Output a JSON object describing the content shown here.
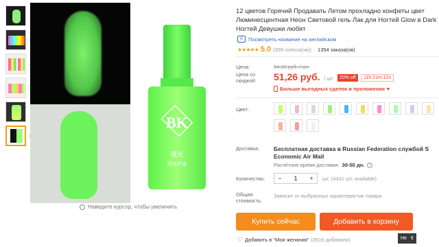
{
  "product": {
    "title_line1": "12 цветов Горячий Продавать Летом прохладно конфеты цвет",
    "title_line2": "Люминесцентная Неон Световой гель Лак для Ногтей Glow в Dark",
    "title_line3": "Ногтей Девушки любят",
    "translate_link": "Посмотреть название на английском",
    "translate_icon": "A",
    "rating": "5.0",
    "stars": "★★★★★",
    "votes": "(359 голоса(ов))",
    "orders": "1354 заказа(ов)"
  },
  "gallery": {
    "zoom_hint": "Наведите курсор, чтобы увеличить",
    "bottle_logo": "BK",
    "bottle_text1": "夜光",
    "bottle_text2": "荧光甲油"
  },
  "pricing": {
    "label_price": "Цена:",
    "old_price": "64,39 руб. / шт.",
    "label_discount_price_1": "Цена со",
    "label_discount_price_2": "скидкой:",
    "price": "51,26 руб.",
    "per_unit": "/ шт.",
    "discount": "20% off",
    "timer": "11h:21m:12s",
    "app_deals": "Больше выгодных сделок в приложении",
    "app_deals_chevron": "▾"
  },
  "options": {
    "label_color": "Цвет:",
    "swatches": [
      "#caff5b",
      "#f5b8c8",
      "#d9d9d9",
      "#9ef07a",
      "#46b8ff",
      "#ffd75b",
      "#ff8ad8",
      "#aaffaa",
      "#d9c7ff",
      "#ffe0b0",
      "#ffb0a0",
      "#ff9a9a",
      "#f6f0e8"
    ]
  },
  "shipping": {
    "label": "Доставка:",
    "main_line1": "Бесплатная доставка в Russian Federation службой S",
    "main_line2": "Economic Air Mail",
    "time_label": "Расчётное время доставки:",
    "time_days": "30-50 дн.",
    "info": "i"
  },
  "quantity": {
    "label": "Количество:",
    "minus": "−",
    "value": "1",
    "plus": "+",
    "available": "шт. (4431 шт. available)",
    "total_label_1": "Общая",
    "total_label_2": "стоимость:",
    "total_hint": "Зависит от выбранных характеристик товара"
  },
  "actions": {
    "buy_now": "Купить сейчас",
    "add_to_cart": "Добавить в корзину",
    "wishlist": "Добавить в \"Мои желания\"",
    "wishlist_count": "(3516 добавили)",
    "heart": "♡",
    "corner": [
      "Не",
      "€"
    ]
  }
}
